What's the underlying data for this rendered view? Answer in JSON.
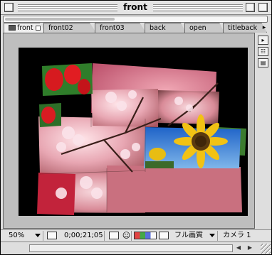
{
  "window": {
    "title": "front"
  },
  "timeline": {
    "progress": 0.42
  },
  "tabs": [
    {
      "label": "front",
      "active": true
    },
    {
      "label": "front02",
      "active": false
    },
    {
      "label": "front03",
      "active": false
    },
    {
      "label": "back",
      "active": false
    },
    {
      "label": "open",
      "active": false
    },
    {
      "label": "titleback",
      "active": false
    }
  ],
  "toolbar": {
    "zoom": "50%",
    "timecode": "0;00;21;05",
    "resolution": "フル画質",
    "camera": "カメラ 1"
  },
  "icons": {
    "close": "close-box-icon",
    "zoom": "zoom-box-icon",
    "collapse": "collapse-box-icon",
    "tab_menu": "tab-menu-arrow-icon",
    "snapshot": "camera-icon",
    "channels": "rgb-channels-icon",
    "region": "region-of-interest-icon",
    "title_safe": "safe-zones-icon"
  },
  "colors": {
    "canvas": "#000000",
    "frame": "#bebebe"
  }
}
